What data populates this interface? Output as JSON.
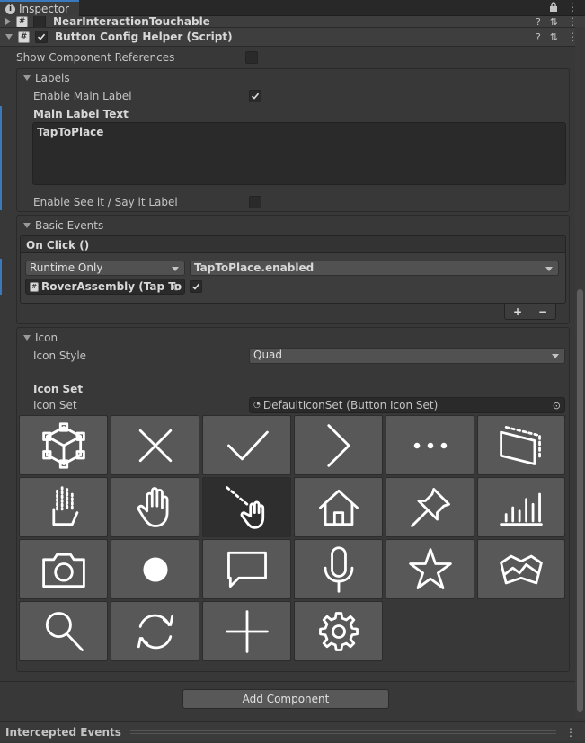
{
  "tab": {
    "title": "Inspector"
  },
  "components": {
    "prev_name": "NearInteractionTouchable",
    "name": "Button Config Helper (Script)"
  },
  "show_component_references": "Show Component References",
  "labels": {
    "title": "Labels",
    "enable_main_label": "Enable Main Label",
    "main_label_text_title": "Main Label Text",
    "main_label_text_value": "TapToPlace",
    "enable_see_it_say_it": "Enable See it / Say it Label"
  },
  "basic_events": {
    "title": "Basic Events",
    "on_click": "On Click ()",
    "runtime": "Runtime Only",
    "function": "TapToPlace.enabled",
    "object": "RoverAssembly (Tap To",
    "plus": "+",
    "minus": "−"
  },
  "icon": {
    "title": "Icon",
    "style_label": "Icon Style",
    "style_value": "Quad",
    "set_header": "Icon Set",
    "set_label": "Icon Set",
    "set_value": "DefaultIconSet (Button Icon Set)",
    "selected_index": 8,
    "icons": [
      "cube-icon",
      "close-icon",
      "checkmark-icon",
      "chevron-right-icon",
      "ellipsis-icon",
      "adjust-icon",
      "hand-joints-icon",
      "hand-icon",
      "hand-ray-icon",
      "home-icon",
      "pin-icon",
      "bar-chart-icon",
      "camera-icon",
      "record-icon",
      "speech-bubble-icon",
      "microphone-icon",
      "star-icon",
      "map-icon",
      "search-icon",
      "refresh-icon",
      "plus-icon",
      "gear-icon"
    ]
  },
  "add_component": "Add Component",
  "intercepted_events": "Intercepted Events",
  "colors": {
    "accent": "#3a79bb",
    "background": "#383838",
    "tile": "#585858",
    "tile_selected": "#2e2e2e"
  }
}
